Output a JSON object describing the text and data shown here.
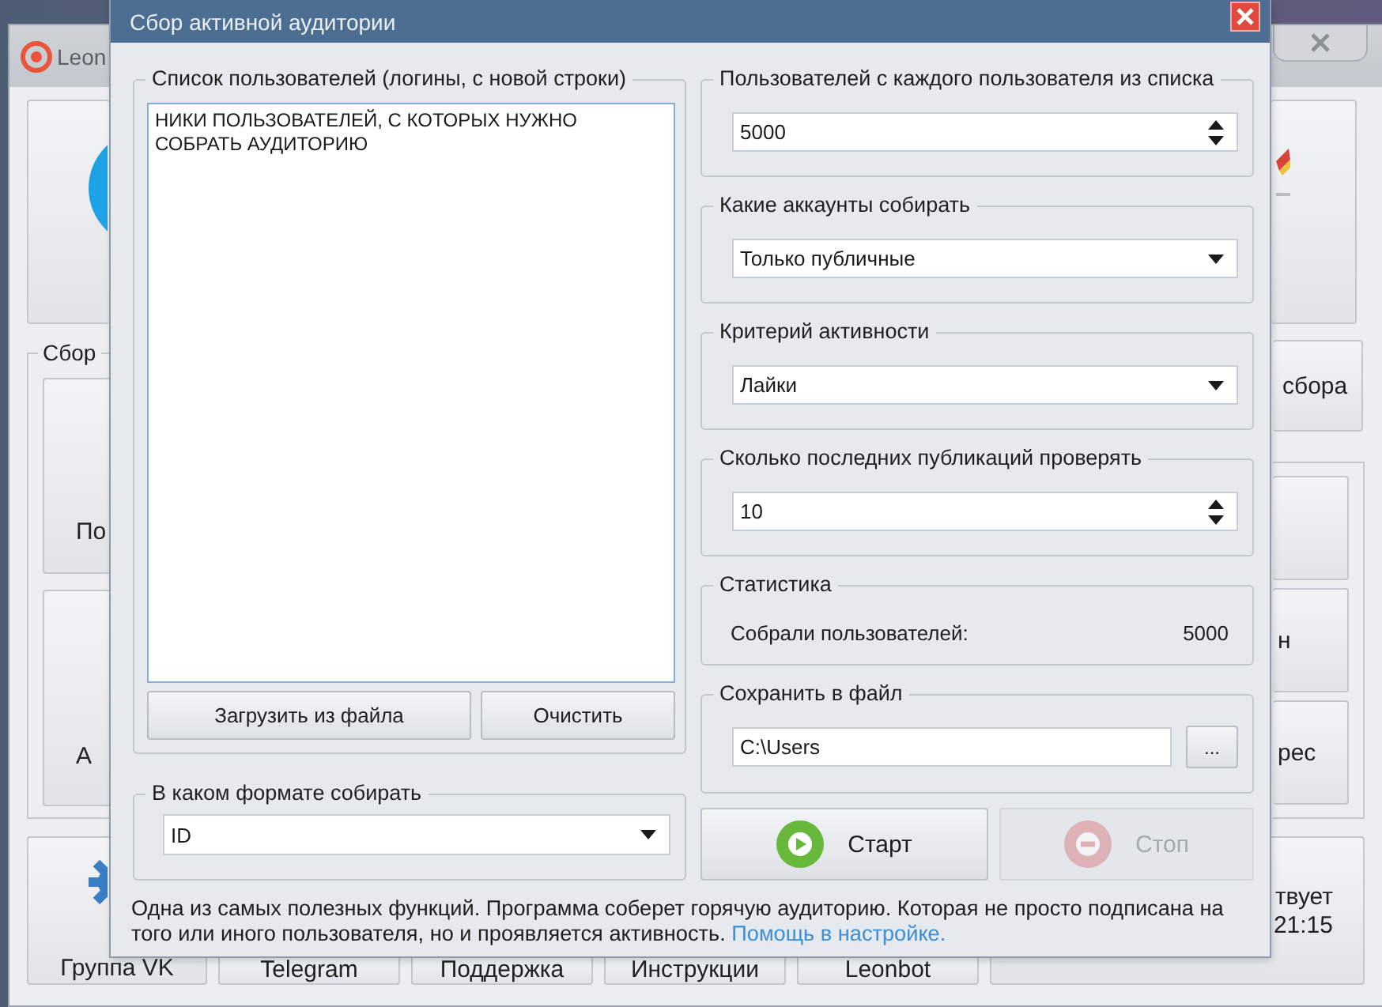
{
  "background_app": {
    "title": "Leon",
    "group_label": "Сбор",
    "left_tiles": [
      "По",
      "А"
    ],
    "right_button": "сбора",
    "right_tiles": [
      "н",
      "рес"
    ],
    "bottom_tiles": [
      "Группа VK",
      "Telegram",
      "Поддержка",
      "Инструкции",
      "Leonbot"
    ],
    "status_panel": [
      "твует",
      "21:15"
    ]
  },
  "dialog": {
    "title": "Сбор активной аудитории",
    "user_list": {
      "label": "Список пользователей (логины, с новой строки)",
      "value": "НИКИ ПОЛЬЗОВАТЕЛЕЙ, С КОТОРЫХ НУЖНО СОБРАТЬ АУДИТОРИЮ",
      "buttons": [
        "Загрузить из файла",
        "Очистить"
      ]
    },
    "format": {
      "label": "В каком формате собирать",
      "value": "ID"
    },
    "settings": [
      {
        "kind": "spinner",
        "label": "Пользователей с каждого пользователя из списка",
        "value": "5000"
      },
      {
        "kind": "dropdown",
        "label": "Какие аккаунты собирать",
        "value": "Только публичные"
      },
      {
        "kind": "dropdown",
        "label": "Критерий активности",
        "value": "Лайки"
      },
      {
        "kind": "spinner",
        "label": "Сколько последних публикаций проверять",
        "value": "10"
      }
    ],
    "statistics": {
      "label": "Статистика",
      "name": "Собрали пользователей:",
      "value": "5000"
    },
    "save": {
      "label": "Сохранить в файл",
      "value": "C:\\Users",
      "browse": "..."
    },
    "actions": [
      {
        "kind": "start",
        "label": "Старт",
        "disabled": false
      },
      {
        "kind": "stop",
        "label": "Стоп",
        "disabled": true
      }
    ],
    "description": {
      "text": "Одна из самых полезных функций. Программа соберет горячую аудиторию. Которая не просто подписана на того или иного пользователя, но и проявляется активность.",
      "link": "Помощь в настройке."
    }
  }
}
